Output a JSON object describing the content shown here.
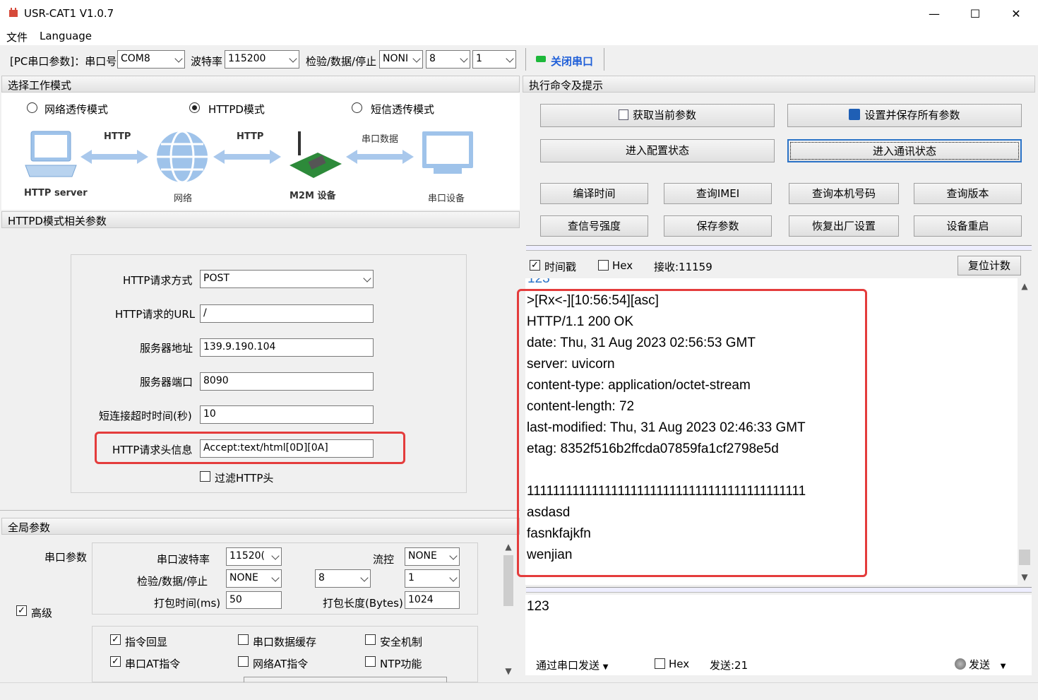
{
  "window": {
    "title": "USR-CAT1 V1.0.7",
    "minimize": "—",
    "maximize": "☐",
    "close": "✕"
  },
  "menu": {
    "file": "文件",
    "language": "Language"
  },
  "toolbar": {
    "pc_params": "[PC串口参数]：串口号",
    "port": "COM8",
    "baud_label": "波特率",
    "baud": "115200",
    "parity_label": "检验/数据/停止",
    "parity": "NONI",
    "databits": "8",
    "stopbits": "1",
    "close_port": "关闭串口"
  },
  "mode": {
    "header": "选择工作模式",
    "opt1": "网络透传模式",
    "opt2": "HTTPD模式",
    "opt3": "短信透传模式",
    "selected": "HTTPD模式"
  },
  "diagram": {
    "http1": "HTTP",
    "http2": "HTTP",
    "serial_data": "串口数据",
    "server": "HTTP server",
    "network": "网络",
    "m2m": "M2M 设备",
    "serial_device": "串口设备"
  },
  "httpd": {
    "header": "HTTPD模式相关参数",
    "method_label": "HTTP请求方式",
    "method": "POST",
    "url_label": "HTTP请求的URL",
    "url": "/",
    "server_label": "服务器地址",
    "server": "139.9.190.104",
    "port_label": "服务器端口",
    "port": "8090",
    "timeout_label": "短连接超时时间(秒)",
    "timeout": "10",
    "header_label": "HTTP请求头信息",
    "header_value": "Accept:text/html[0D][0A]",
    "filter_label": "过滤HTTP头"
  },
  "global": {
    "header": "全局参数",
    "serial_params": "串口参数",
    "baud_label": "串口波特率",
    "baud": "11520(",
    "flow_label": "流控",
    "flow": "NONE",
    "parity_label": "检验/数据/停止",
    "parity": "NONE",
    "databits": "8",
    "stopbits": "1",
    "pack_time_label": "打包时间(ms)",
    "pack_time": "50",
    "pack_len_label": "打包长度(Bytes)",
    "pack_len": "1024",
    "advanced": "高级",
    "echo": "指令回显",
    "cache": "串口数据缓存",
    "security": "安全机制",
    "serial_at": "串口AT指令",
    "net_at": "网络AT指令",
    "ntp": "NTP功能"
  },
  "commands": {
    "header": "执行命令及提示",
    "get_params": "获取当前参数",
    "save_all": "设置并保存所有参数",
    "enter_config": "进入配置状态",
    "enter_comm": "进入通讯状态",
    "compile_time": "编译时间",
    "query_imei": "查询IMEI",
    "query_number": "查询本机号码",
    "query_version": "查询版本",
    "query_signal": "查信号强度",
    "save_params": "保存参数",
    "factory_reset": "恢复出厂设置",
    "reboot": "设备重启"
  },
  "receive": {
    "timestamp": "时间戳",
    "hex": "Hex",
    "received": "接收:11159",
    "reset_count": "复位计数",
    "partial": "123",
    "lines": [
      ">[Rx<-][10:56:54][asc]",
      "HTTP/1.1 200 OK",
      "date: Thu, 31 Aug 2023 02:56:53 GMT",
      "server: uvicorn",
      "content-type: application/octet-stream",
      "content-length: 72",
      "last-modified: Thu, 31 Aug 2023 02:46:33 GMT",
      "etag: 8352f516b2ffcda07859fa1cf2798e5d",
      "",
      "1111111111111111111111111111111111111111111",
      "asdasd",
      "fasnkfajkfn",
      "wenjian"
    ]
  },
  "send": {
    "text": "123",
    "via": "通过串口发送",
    "hex": "Hex",
    "sent": "发送:21",
    "send_button": "发送"
  },
  "colors": {
    "accent": "#2b73c7",
    "highlight": "#e43c3c",
    "led": "#1db83a"
  }
}
